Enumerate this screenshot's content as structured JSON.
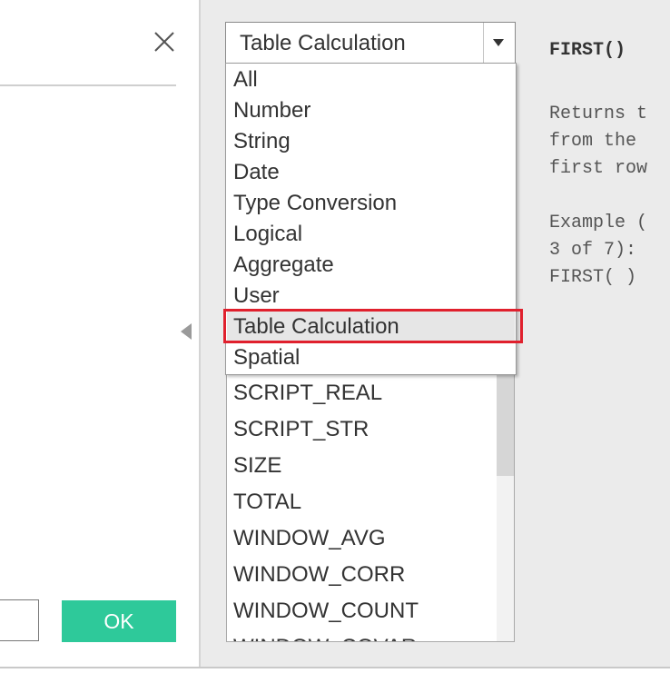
{
  "dialog": {
    "close_icon": "close-icon",
    "ok_label": "OK"
  },
  "category_select": {
    "value": "Table Calculation",
    "arrow_icon": "chevron-down-icon",
    "options": [
      "All",
      "Number",
      "String",
      "Date",
      "Type Conversion",
      "Logical",
      "Aggregate",
      "User",
      "Table Calculation",
      "Spatial"
    ],
    "selected_index": 8
  },
  "functions": {
    "items": [
      "SCRIPT_REAL",
      "SCRIPT_STR",
      "SIZE",
      "TOTAL",
      "WINDOW_AVG",
      "WINDOW_CORR",
      "WINDOW_COUNT",
      "WINDOW_COVAR"
    ]
  },
  "help": {
    "signature": "FIRST()",
    "lines": [
      "Returns t",
      "from the",
      "first row",
      "",
      "Example (",
      "3 of 7):",
      "FIRST( )"
    ]
  },
  "colors": {
    "ok_button": "#2ec99a",
    "highlight": "#e0202d"
  }
}
